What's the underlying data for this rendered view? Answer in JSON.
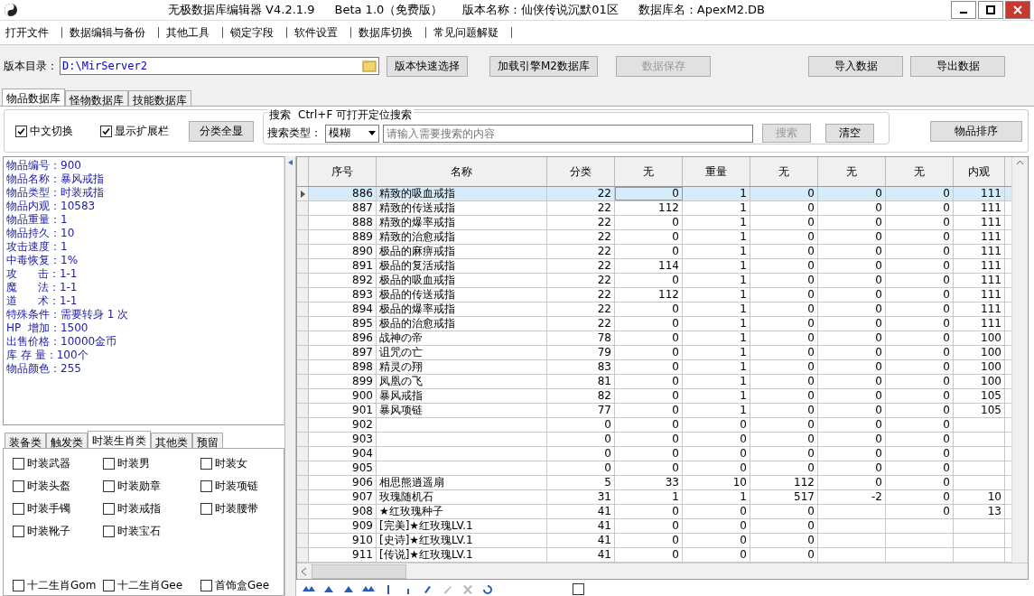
{
  "window": {
    "title_parts": [
      "无极数据库编辑器 V4.2.1.9",
      "Beta 1.0（免费版）",
      "版本名称：仙侠传说沉默01区",
      "数据库名：ApexM2.DB"
    ]
  },
  "menu": [
    "打开文件",
    "数据编辑与备份",
    "其他工具",
    "锁定字段",
    "软件设置",
    "数据库切换",
    "常见问题解疑"
  ],
  "path_bar": {
    "label": "版本目录：",
    "value": "D:\\MirServer2",
    "buttons": [
      {
        "label": "版本快速选择",
        "disabled": false
      },
      {
        "label": "加载引擎M2数据库",
        "disabled": false
      },
      {
        "label": "数据保存",
        "disabled": true
      },
      {
        "label": "导入数据",
        "disabled": false
      },
      {
        "label": "导出数据",
        "disabled": false
      }
    ]
  },
  "tabs": [
    {
      "label": "物品数据库",
      "selected": true
    },
    {
      "label": "怪物数据库",
      "selected": false
    },
    {
      "label": "技能数据库",
      "selected": false
    }
  ],
  "options": [
    {
      "label": "中文切换",
      "checked": true
    },
    {
      "label": "显示扩展栏",
      "checked": true
    }
  ],
  "show_all_button": "分类全显",
  "search": {
    "title": "搜索",
    "hint": "Ctrl+F 可打开定位搜索",
    "type_label": "搜索类型：",
    "type_value": "模糊",
    "placeholder": "请输入需要搜索的内容",
    "search_button": {
      "label": "搜索",
      "disabled": true
    },
    "clear_button": {
      "label": "清空",
      "disabled": false
    }
  },
  "sort_button": "物品排序",
  "item_info": [
    "物品编号：900",
    "物品名称：暴风戒指",
    "物品类型：时装戒指",
    "物品内观：10583",
    "物品重量：1",
    "物品持久：10",
    "攻击速度：1",
    "中毒恢复：1%",
    "攻      击：1-1",
    "魔      法：1-1",
    "道      术：1-1",
    "特殊条件：需要转身 1 次",
    "HP  增加：1500",
    "出售价格：10000金币",
    "库 存 量：100个",
    "物品颜色：255"
  ],
  "category_tabs": [
    {
      "label": "装备类",
      "selected": false
    },
    {
      "label": "触发类",
      "selected": false
    },
    {
      "label": "时装生肖类",
      "selected": true
    },
    {
      "label": "其他类",
      "selected": false
    },
    {
      "label": "预留",
      "selected": false
    }
  ],
  "category_checks": [
    {
      "label": "时装武器",
      "checked": false
    },
    {
      "label": "时装男",
      "checked": false
    },
    {
      "label": "时装女",
      "checked": false
    },
    {
      "label": "时装头盔",
      "checked": false
    },
    {
      "label": "时装勋章",
      "checked": false
    },
    {
      "label": "时装项链",
      "checked": false
    },
    {
      "label": "时装手镯",
      "checked": false
    },
    {
      "label": "时装戒指",
      "checked": false
    },
    {
      "label": "时装腰带",
      "checked": false
    },
    {
      "label": "时装靴子",
      "checked": false
    },
    {
      "label": "时装宝石",
      "checked": false
    }
  ],
  "extra_checks": [
    {
      "label": "十二生肖Gom",
      "checked": false
    },
    {
      "label": "十二生肖Gee",
      "checked": false
    },
    {
      "label": "首饰盒Gee",
      "checked": false
    }
  ],
  "grid": {
    "columns": [
      "序号",
      "名称",
      "分类",
      "无",
      "重量",
      "无",
      "无",
      "无",
      "内观"
    ],
    "rows": [
      {
        "selected": true,
        "cells": {
          "number": "886",
          "name": "精致的吸血戒指",
          "category": "22",
          "column_4": "0",
          "weight": "1",
          "column_6": "0",
          "column_7": "0",
          "column_8": "0",
          "appearance": "111"
        }
      },
      {
        "selected": false,
        "cells": {
          "number": "887",
          "name": "精致的传送戒指",
          "category": "22",
          "column_4": "112",
          "weight": "1",
          "column_6": "0",
          "column_7": "0",
          "column_8": "0",
          "appearance": "111"
        }
      },
      {
        "selected": false,
        "cells": {
          "number": "888",
          "name": "精致的爆率戒指",
          "category": "22",
          "column_4": "0",
          "weight": "1",
          "column_6": "0",
          "column_7": "0",
          "column_8": "0",
          "appearance": "111"
        }
      },
      {
        "selected": false,
        "cells": {
          "number": "889",
          "name": "精致的治愈戒指",
          "category": "22",
          "column_4": "0",
          "weight": "1",
          "column_6": "0",
          "column_7": "0",
          "column_8": "0",
          "appearance": "111"
        }
      },
      {
        "selected": false,
        "cells": {
          "number": "890",
          "name": "极品的麻痹戒指",
          "category": "22",
          "column_4": "0",
          "weight": "1",
          "column_6": "0",
          "column_7": "0",
          "column_8": "0",
          "appearance": "111"
        }
      },
      {
        "selected": false,
        "cells": {
          "number": "891",
          "name": "极品的复活戒指",
          "category": "22",
          "column_4": "114",
          "weight": "1",
          "column_6": "0",
          "column_7": "0",
          "column_8": "0",
          "appearance": "111"
        }
      },
      {
        "selected": false,
        "cells": {
          "number": "892",
          "name": "极品的吸血戒指",
          "category": "22",
          "column_4": "0",
          "weight": "1",
          "column_6": "0",
          "column_7": "0",
          "column_8": "0",
          "appearance": "111"
        }
      },
      {
        "selected": false,
        "cells": {
          "number": "893",
          "name": "极品的传送戒指",
          "category": "22",
          "column_4": "112",
          "weight": "1",
          "column_6": "0",
          "column_7": "0",
          "column_8": "0",
          "appearance": "111"
        }
      },
      {
        "selected": false,
        "cells": {
          "number": "894",
          "name": "极品的爆率戒指",
          "category": "22",
          "column_4": "0",
          "weight": "1",
          "column_6": "0",
          "column_7": "0",
          "column_8": "0",
          "appearance": "111"
        }
      },
      {
        "selected": false,
        "cells": {
          "number": "895",
          "name": "极品的治愈戒指",
          "category": "22",
          "column_4": "0",
          "weight": "1",
          "column_6": "0",
          "column_7": "0",
          "column_8": "0",
          "appearance": "111"
        }
      },
      {
        "selected": false,
        "cells": {
          "number": "896",
          "name": "战神の帝",
          "category": "78",
          "column_4": "0",
          "weight": "1",
          "column_6": "0",
          "column_7": "0",
          "column_8": "0",
          "appearance": "100"
        }
      },
      {
        "selected": false,
        "cells": {
          "number": "897",
          "name": "诅咒の亡",
          "category": "79",
          "column_4": "0",
          "weight": "1",
          "column_6": "0",
          "column_7": "0",
          "column_8": "0",
          "appearance": "100"
        }
      },
      {
        "selected": false,
        "cells": {
          "number": "898",
          "name": "精灵の翔",
          "category": "83",
          "column_4": "0",
          "weight": "1",
          "column_6": "0",
          "column_7": "0",
          "column_8": "0",
          "appearance": "100"
        }
      },
      {
        "selected": false,
        "cells": {
          "number": "899",
          "name": "凤凰の飞",
          "category": "81",
          "column_4": "0",
          "weight": "1",
          "column_6": "0",
          "column_7": "0",
          "column_8": "0",
          "appearance": "100"
        }
      },
      {
        "selected": false,
        "cells": {
          "number": "900",
          "name": "暴风戒指",
          "category": "82",
          "column_4": "0",
          "weight": "1",
          "column_6": "0",
          "column_7": "0",
          "column_8": "0",
          "appearance": "105"
        }
      },
      {
        "selected": false,
        "cells": {
          "number": "901",
          "name": "暴风项链",
          "category": "77",
          "column_4": "0",
          "weight": "1",
          "column_6": "0",
          "column_7": "0",
          "column_8": "0",
          "appearance": "105"
        }
      },
      {
        "selected": false,
        "cells": {
          "number": "902",
          "category": "0",
          "column_4": "0",
          "weight": "0",
          "column_6": "0",
          "column_7": "0",
          "column_8": "0"
        }
      },
      {
        "selected": false,
        "cells": {
          "number": "903",
          "category": "0",
          "column_4": "0",
          "weight": "0",
          "column_6": "0",
          "column_7": "0",
          "column_8": "0"
        }
      },
      {
        "selected": false,
        "cells": {
          "number": "904",
          "category": "0",
          "column_4": "0",
          "weight": "0",
          "column_6": "0",
          "column_7": "0",
          "column_8": "0"
        }
      },
      {
        "selected": false,
        "cells": {
          "number": "905",
          "category": "0",
          "column_4": "0",
          "weight": "0",
          "column_6": "0",
          "column_7": "0",
          "column_8": "0"
        }
      },
      {
        "selected": false,
        "cells": {
          "number": "906",
          "name": "相思熊逍遥扇",
          "category": "5",
          "column_4": "33",
          "weight": "10",
          "column_6": "112",
          "column_7": "0",
          "column_8": "0"
        }
      },
      {
        "selected": false,
        "cells": {
          "number": "907",
          "name": "玫瑰随机石",
          "category": "31",
          "column_4": "1",
          "weight": "1",
          "column_6": "517",
          "column_7": "-2",
          "column_8": "0",
          "appearance": "10"
        }
      },
      {
        "selected": false,
        "cells": {
          "number": "908",
          "name": "★红玫瑰种子",
          "category": "41",
          "column_4": "0",
          "weight": "0",
          "column_6": "0",
          "column_8": "0",
          "appearance": "13"
        }
      },
      {
        "selected": false,
        "cells": {
          "number": "909",
          "name": "[完美]★红玫瑰LV.1",
          "category": "41",
          "column_4": "0",
          "weight": "0",
          "column_6": "0"
        }
      },
      {
        "selected": false,
        "cells": {
          "number": "910",
          "name": "[史诗]★红玫瑰LV.1",
          "category": "41",
          "column_4": "0",
          "weight": "0",
          "column_6": "0"
        }
      },
      {
        "selected": false,
        "cells": {
          "number": "911",
          "name": "[传说]★红玫瑰LV.1",
          "category": "41",
          "column_4": "0",
          "weight": "0",
          "column_6": "0"
        }
      }
    ]
  },
  "navigator": {
    "checkbox_checked": false
  }
}
